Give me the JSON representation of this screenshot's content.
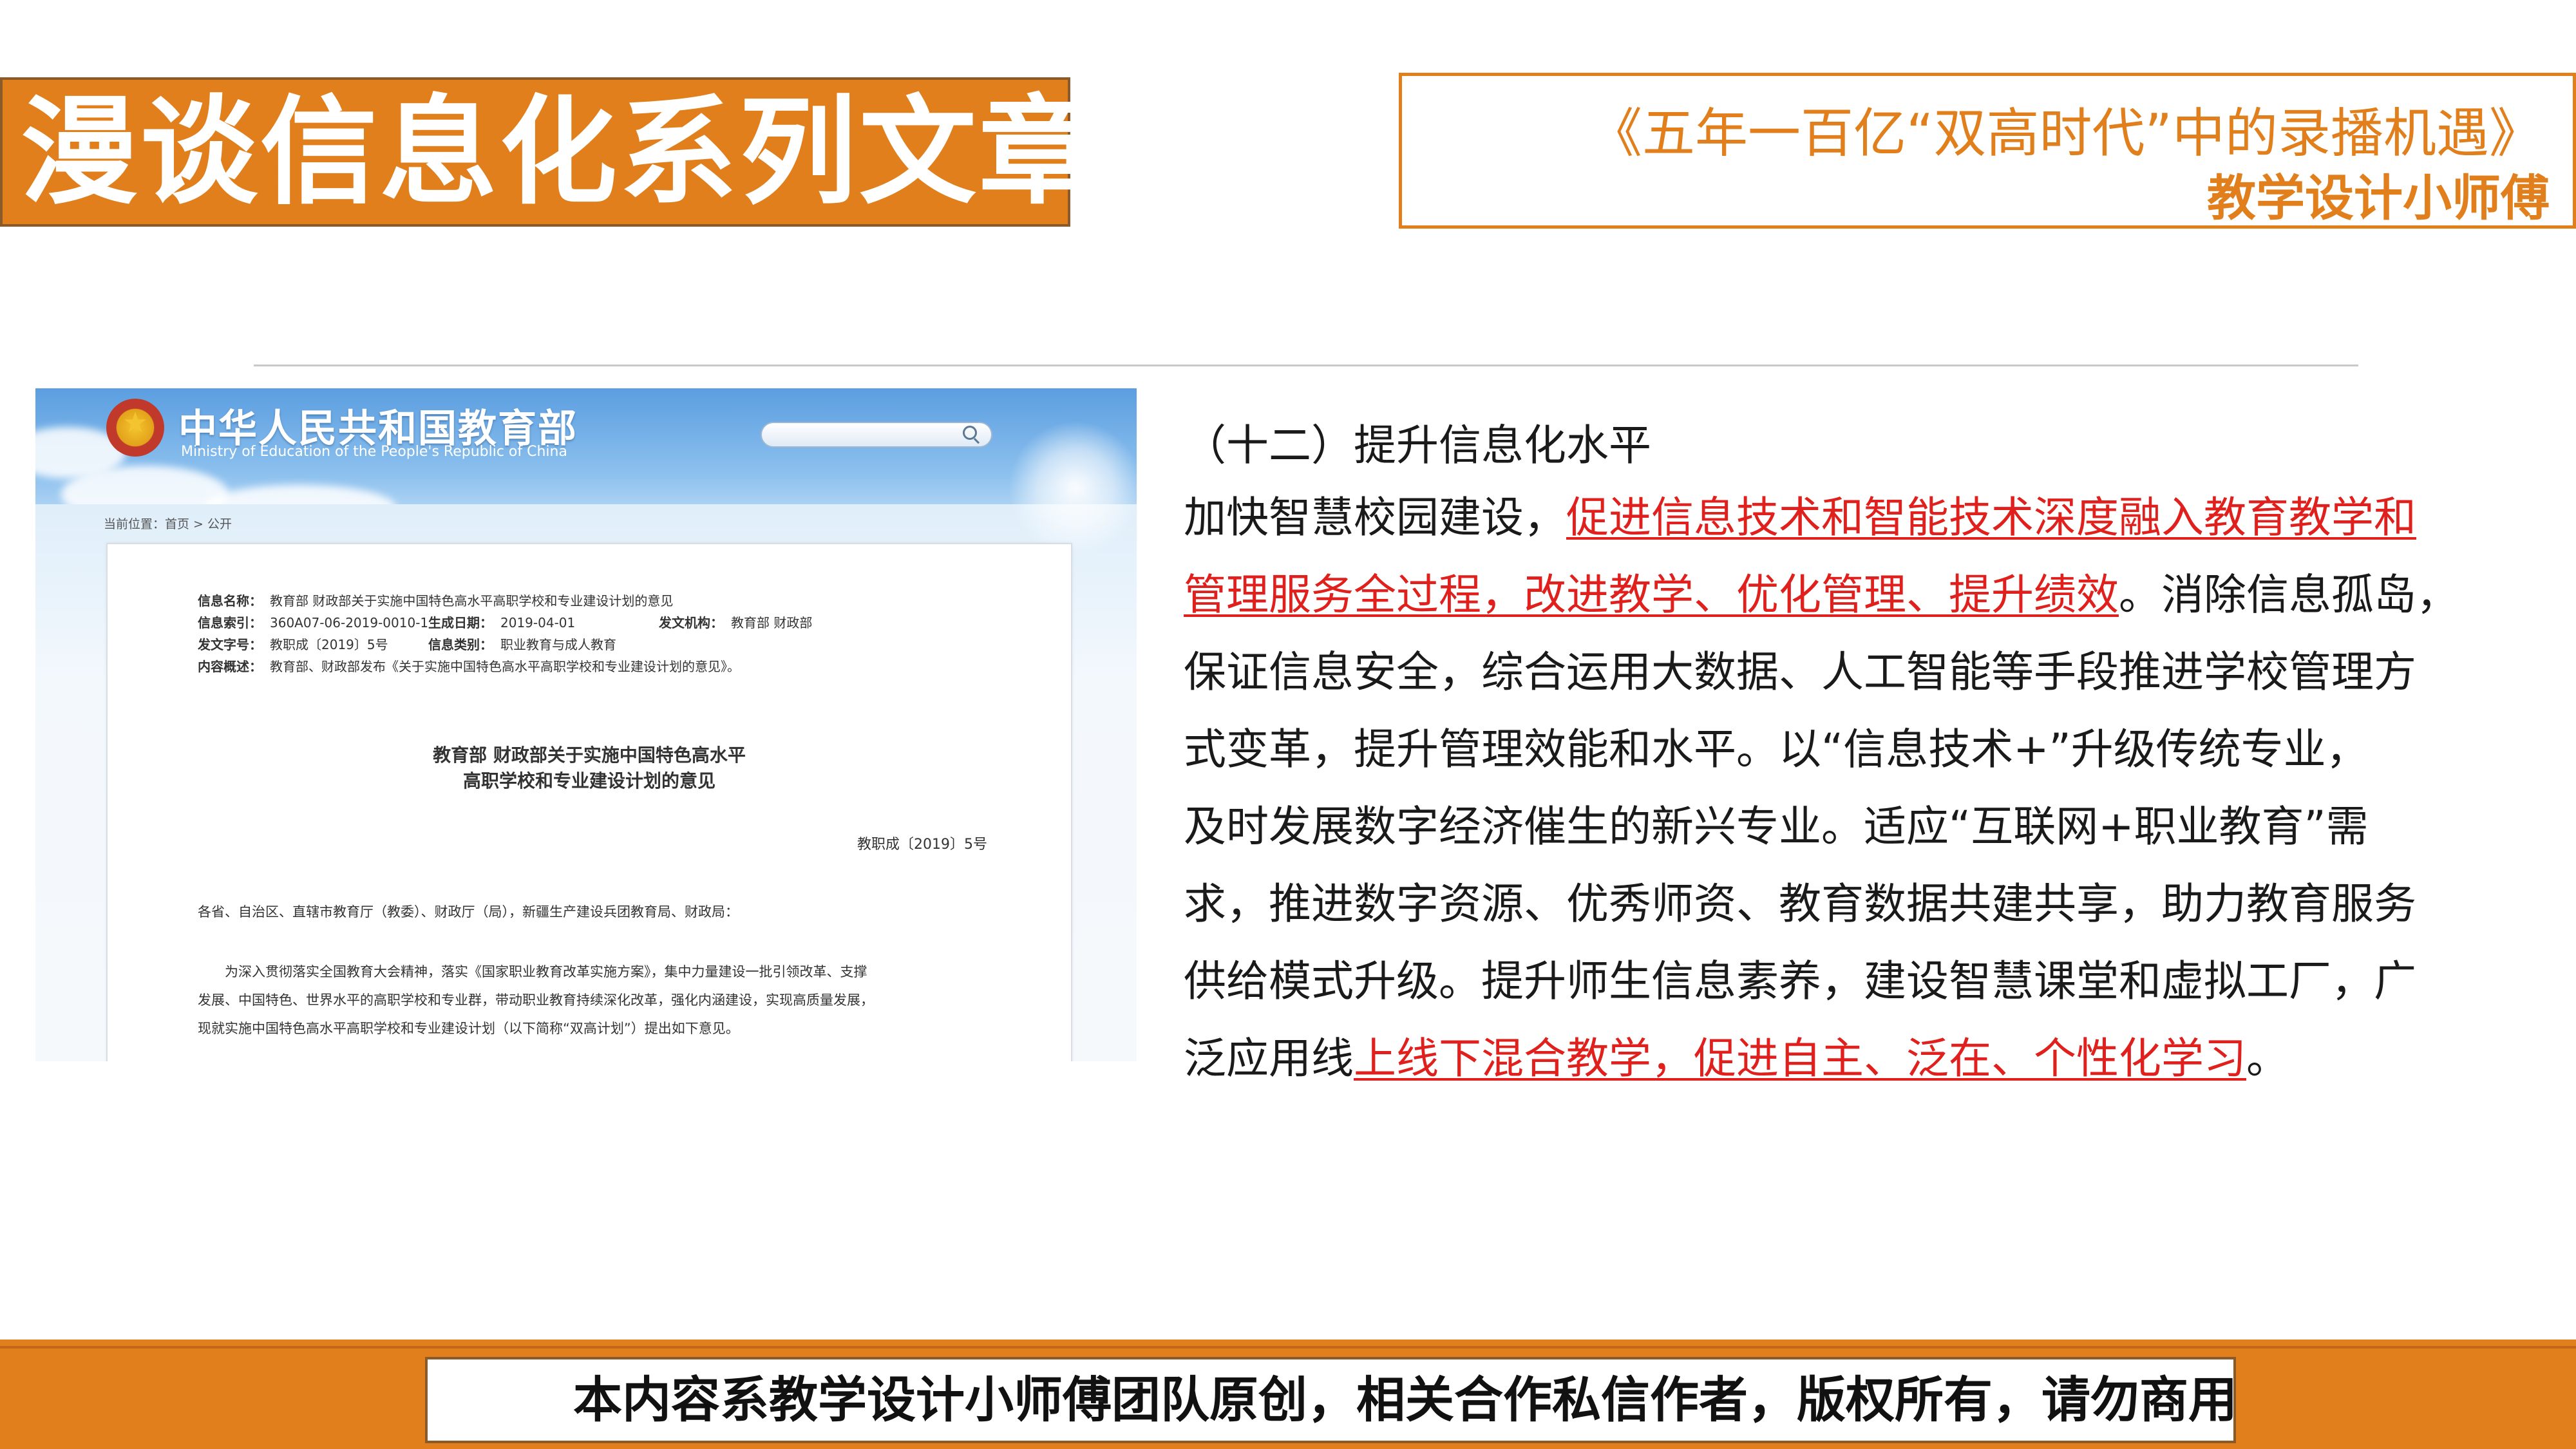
{
  "header": {
    "series_title": "漫谈信息化系列文章",
    "article_title": "《五年一百亿“双高时代”中的录播机遇》",
    "author": "教学设计小师傅"
  },
  "screenshot": {
    "ministry_name_cn": "中华人民共和国教育部",
    "ministry_name_en": "Ministry of Education of the People's Republic of China",
    "breadcrumb": "当前位置：首页 > 公开",
    "meta": {
      "info_name_label": "信息名称：",
      "info_name_value": "教育部 财政部关于实施中国特色高水平高职学校和专业建设计划的意见",
      "info_index_label": "信息索引：",
      "info_index_value": "360A07-06-2019-0010-1",
      "date_label": "生成日期：",
      "date_value": "2019-04-01",
      "issuer_label": "发文机构：",
      "issuer_value": "教育部 财政部",
      "doc_no_label": "发文字号：",
      "doc_no_value": "教职成〔2019〕5号",
      "category_label": "信息类别：",
      "category_value": "职业教育与成人教育",
      "summary_label": "内容概述：",
      "summary_value": "教育部、财政部发布《关于实施中国特色高水平高职学校和专业建设计划的意见》。"
    },
    "doc_title_line1": "教育部 财政部关于实施中国特色高水平",
    "doc_title_line2": "高职学校和专业建设计划的意见",
    "doc_number": "教职成〔2019〕5号",
    "recipients": "各省、自治区、直辖市教育厅（教委）、财政厅（局），新疆生产建设兵团教育局、财政局：",
    "para_line1": "为深入贯彻落实全国教育大会精神，落实《国家职业教育改革实施方案》，集中力量建设一批引领改革、支撑",
    "para_line2": "发展、中国特色、世界水平的高职学校和专业群，带动职业教育持续深化改革，强化内涵建设，实现高质量发展，",
    "para_line3": "现就实施中国特色高水平高职学校和专业建设计划（以下简称“双高计划”）提出如下意见。"
  },
  "body": {
    "heading": "（十二）提升信息化水平",
    "l1_a": "加快智慧校园建设，",
    "l1_b": "促进信息技术和智能技术深度融入教育教学和",
    "l2_a": "管理服务全过程，改进教学、优化管理、提升绩效",
    "l2_b": "。消除信息孤岛，",
    "l3": "保证信息安全，综合运用大数据、人工智能等手段推进学校管理方",
    "l4": "式变革，提升管理效能和水平。以“信息技术+”升级传统专业，",
    "l5": "及时发展数字经济催生的新兴专业。适应“互联网+职业教育”需",
    "l6": "求，推进数字资源、优秀师资、教育数据共建共享，助力教育服务",
    "l7": "供给模式升级。提升师生信息素养，建设智慧课堂和虚拟工厂，广",
    "l8_a": "泛应用线",
    "l8_b": "上线下混合教学，促进自主、泛在、个性化学习",
    "l8_c": "。"
  },
  "footer": {
    "notice": "本内容系教学设计小师傅团队原创，相关合作私信作者，版权所有，请勿商用"
  },
  "colors": {
    "accent": "#e07f1c",
    "highlight": "#e0201c"
  }
}
